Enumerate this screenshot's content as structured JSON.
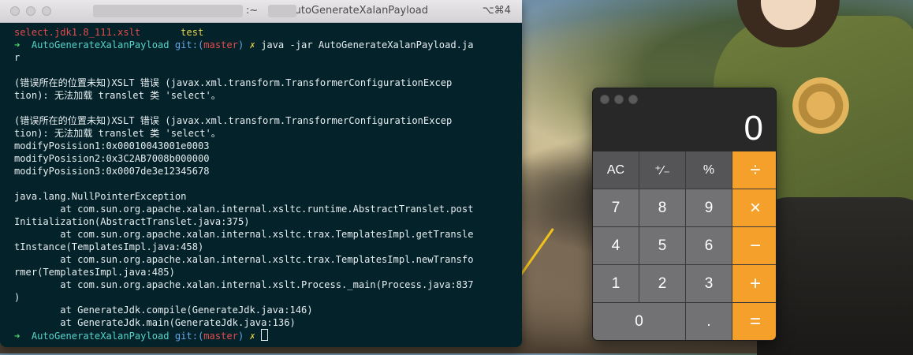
{
  "terminal": {
    "title": "/AutoGenerateXalanPayload",
    "title_prefix": ":~",
    "shortcut": "⌥⌘4",
    "lines": [
      [
        {
          "t": "select.jdk1.8_111.xslt       ",
          "c": "c-red"
        },
        {
          "t": "test",
          "c": "c-yellow"
        }
      ],
      [
        {
          "t": "➜  ",
          "c": "c-green"
        },
        {
          "t": "AutoGenerateXalanPayload ",
          "c": "c-cyan"
        },
        {
          "t": "git:(",
          "c": "c-blue"
        },
        {
          "t": "master",
          "c": "c-red"
        },
        {
          "t": ") ",
          "c": "c-blue"
        },
        {
          "t": "✗ ",
          "c": "c-yellow"
        },
        {
          "t": "java -jar AutoGenerateXalanPayload.ja",
          "c": "c-white"
        }
      ],
      [
        {
          "t": "r",
          "c": "c-white"
        }
      ],
      [
        {
          "t": "",
          "c": "c-white"
        }
      ],
      [
        {
          "t": "(错误所在的位置未知)XSLT 错误 (javax.xml.transform.TransformerConfigurationExcep",
          "c": "c-white"
        }
      ],
      [
        {
          "t": "tion): 无法加载 translet 类 'select'。",
          "c": "c-white"
        }
      ],
      [
        {
          "t": "",
          "c": "c-white"
        }
      ],
      [
        {
          "t": "(错误所在的位置未知)XSLT 错误 (javax.xml.transform.TransformerConfigurationExcep",
          "c": "c-white"
        }
      ],
      [
        {
          "t": "tion): 无法加载 translet 类 'select'。",
          "c": "c-white"
        }
      ],
      [
        {
          "t": "modifyPosision1:0x00010043001e0003",
          "c": "c-white"
        }
      ],
      [
        {
          "t": "modifyPosision2:0x3C2AB7008b000000",
          "c": "c-white"
        }
      ],
      [
        {
          "t": "modifyPosision3:0x0007de3e12345678",
          "c": "c-white"
        }
      ],
      [
        {
          "t": "",
          "c": "c-white"
        }
      ],
      [
        {
          "t": "java.lang.NullPointerException",
          "c": "c-white"
        }
      ],
      [
        {
          "t": "        at com.sun.org.apache.xalan.internal.xsltc.runtime.AbstractTranslet.post",
          "c": "c-white"
        }
      ],
      [
        {
          "t": "Initialization(AbstractTranslet.java:375)",
          "c": "c-white"
        }
      ],
      [
        {
          "t": "        at com.sun.org.apache.xalan.internal.xsltc.trax.TemplatesImpl.getTransle",
          "c": "c-white"
        }
      ],
      [
        {
          "t": "tInstance(TemplatesImpl.java:458)",
          "c": "c-white"
        }
      ],
      [
        {
          "t": "        at com.sun.org.apache.xalan.internal.xsltc.trax.TemplatesImpl.newTransfo",
          "c": "c-white"
        }
      ],
      [
        {
          "t": "rmer(TemplatesImpl.java:485)",
          "c": "c-white"
        }
      ],
      [
        {
          "t": "        at com.sun.org.apache.xalan.internal.xslt.Process._main(Process.java:837",
          "c": "c-white"
        }
      ],
      [
        {
          "t": ")",
          "c": "c-white"
        }
      ],
      [
        {
          "t": "        at GenerateJdk.compile(GenerateJdk.java:146)",
          "c": "c-white"
        }
      ],
      [
        {
          "t": "        at GenerateJdk.main(GenerateJdk.java:136)",
          "c": "c-white"
        }
      ]
    ],
    "prompt": {
      "arrow": "➜  ",
      "dir": "AutoGenerateXalanPayload ",
      "git_open": "git:(",
      "branch": "master",
      "git_close": ") ",
      "dirty": "✗ "
    }
  },
  "calculator": {
    "display": "0",
    "keys": [
      {
        "label": "AC",
        "kind": "k-fn",
        "name": "clear-button"
      },
      {
        "label": "⁺∕₋",
        "kind": "k-fn",
        "name": "sign-toggle-button"
      },
      {
        "label": "%",
        "kind": "k-fn",
        "name": "percent-button"
      },
      {
        "label": "÷",
        "kind": "k-op",
        "name": "divide-button"
      },
      {
        "label": "7",
        "kind": "k-num",
        "name": "digit-7-button"
      },
      {
        "label": "8",
        "kind": "k-num",
        "name": "digit-8-button"
      },
      {
        "label": "9",
        "kind": "k-num",
        "name": "digit-9-button"
      },
      {
        "label": "×",
        "kind": "k-op",
        "name": "multiply-button"
      },
      {
        "label": "4",
        "kind": "k-num",
        "name": "digit-4-button"
      },
      {
        "label": "5",
        "kind": "k-num",
        "name": "digit-5-button"
      },
      {
        "label": "6",
        "kind": "k-num",
        "name": "digit-6-button"
      },
      {
        "label": "−",
        "kind": "k-op",
        "name": "subtract-button"
      },
      {
        "label": "1",
        "kind": "k-num",
        "name": "digit-1-button"
      },
      {
        "label": "2",
        "kind": "k-num",
        "name": "digit-2-button"
      },
      {
        "label": "3",
        "kind": "k-num",
        "name": "digit-3-button"
      },
      {
        "label": "+",
        "kind": "k-op",
        "name": "add-button"
      },
      {
        "label": "0",
        "kind": "k-num k-zero",
        "name": "digit-0-button"
      },
      {
        "label": ".",
        "kind": "k-num",
        "name": "decimal-button"
      },
      {
        "label": "=",
        "kind": "k-op",
        "name": "equals-button"
      }
    ]
  }
}
